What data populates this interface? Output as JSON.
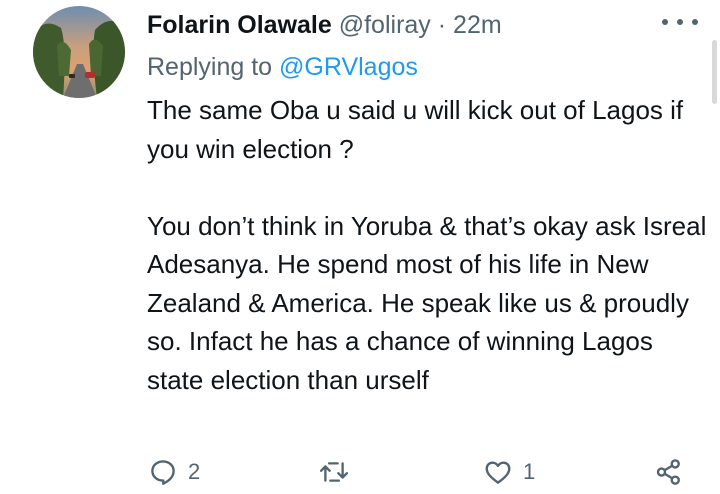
{
  "tweet": {
    "author_name": "Folarin Olawale",
    "author_handle": "@foliray",
    "separator": "·",
    "timestamp": "22m",
    "reply_prefix": "Replying to",
    "reply_mention": "@GRVlagos",
    "paragraphs": [
      "The same Oba u said u will kick out of Lagos if you win election ?",
      "You don’t think in Yoruba & that’s okay ask Isreal Adesanya. He spend most of his life in New Zealand & America. He speak like us & proudly so. Infact he has a chance of winning Lagos state election than urself"
    ]
  },
  "actions": {
    "reply_count": "2",
    "retweet_count": "",
    "like_count": "1"
  },
  "icons": {
    "more": "more-icon",
    "reply": "reply-icon",
    "retweet": "retweet-icon",
    "like": "heart-icon",
    "share": "share-icon"
  },
  "colors": {
    "text": "#0f1419",
    "secondary": "#536471",
    "link": "#1d9bf0"
  }
}
